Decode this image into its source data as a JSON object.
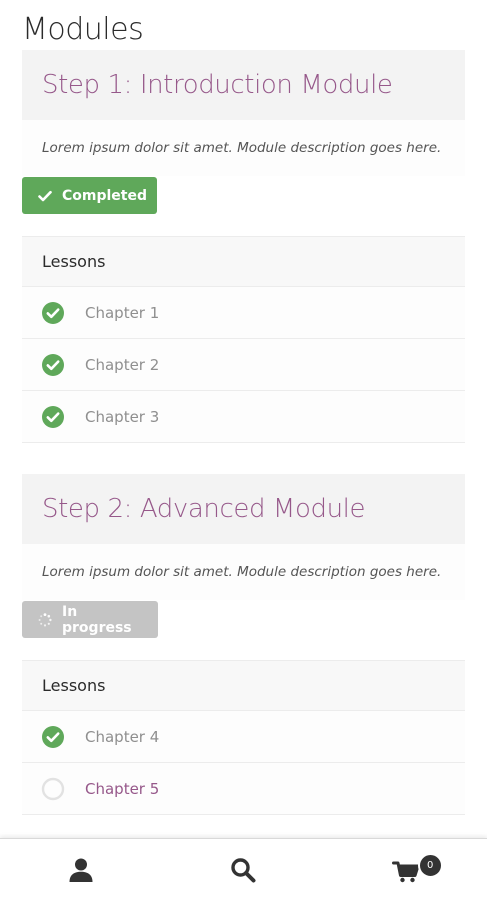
{
  "page": {
    "title": "Modules"
  },
  "modules": [
    {
      "title": "Step 1: Introduction Module",
      "description": "Lorem ipsum dolor sit amet. Module description goes here.",
      "status": {
        "label": "Completed",
        "icon": "check-icon",
        "color": "#5fa85a"
      },
      "lessons_header": "Lessons",
      "lessons": [
        {
          "label": "Chapter 1",
          "state": "completed"
        },
        {
          "label": "Chapter 2",
          "state": "completed"
        },
        {
          "label": "Chapter 3",
          "state": "completed"
        }
      ]
    },
    {
      "title": "Step 2: Advanced Module",
      "description": "Lorem ipsum dolor sit amet. Module description goes here.",
      "status": {
        "label": "In progress",
        "icon": "spinner-icon",
        "color": "#c4c4c4"
      },
      "lessons_header": "Lessons",
      "lessons": [
        {
          "label": "Chapter 4",
          "state": "completed"
        },
        {
          "label": "Chapter 5",
          "state": "not-started"
        }
      ]
    }
  ],
  "bottom_bar": {
    "items": [
      {
        "icon": "user-icon"
      },
      {
        "icon": "search-icon"
      },
      {
        "icon": "cart-icon",
        "badge": "0"
      }
    ]
  },
  "colors": {
    "accent": "#96588a",
    "complete": "#5fa85a",
    "pending": "#c4c4c4"
  }
}
